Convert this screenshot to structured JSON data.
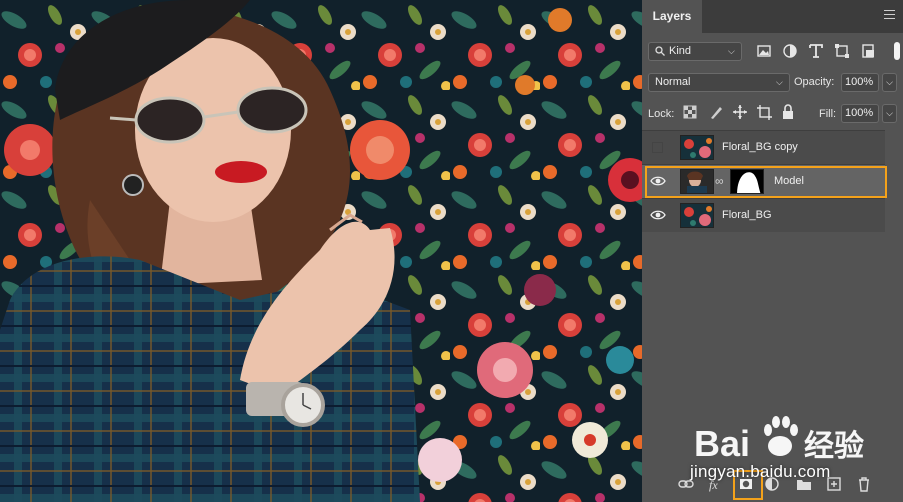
{
  "panel": {
    "tab_label": "Layers",
    "filter": {
      "kind_label": "Kind"
    },
    "blend_mode": "Normal",
    "opacity_label": "Opacity:",
    "opacity_value": "100%",
    "lock_label": "Lock:",
    "fill_label": "Fill:",
    "fill_value": "100%",
    "layers": [
      {
        "name": "Floral_BG copy",
        "visible": false,
        "selected": false
      },
      {
        "name": "Model",
        "visible": true,
        "selected": true,
        "has_mask": true
      },
      {
        "name": "Floral_BG",
        "visible": true,
        "selected": false
      }
    ]
  },
  "icons": {
    "filter": [
      "search-icon",
      "image-filter-icon",
      "adjustment-filter-icon",
      "type-filter-icon",
      "shape-filter-icon",
      "smart-object-filter-icon"
    ],
    "lock": [
      "lock-transparent-icon",
      "lock-image-icon",
      "lock-position-icon",
      "lock-artboard-icon",
      "lock-all-icon"
    ],
    "bottom": [
      "link-layers-icon",
      "fx-icon",
      "add-mask-icon",
      "adjustment-layer-icon",
      "group-icon",
      "new-layer-icon",
      "trash-icon"
    ]
  },
  "accent": {
    "highlight": "#f4a21b",
    "panel_bg": "#535353"
  },
  "watermark": {
    "brand": "Bai",
    "brand2": "经验",
    "url": "jingyan.baidu.com"
  }
}
